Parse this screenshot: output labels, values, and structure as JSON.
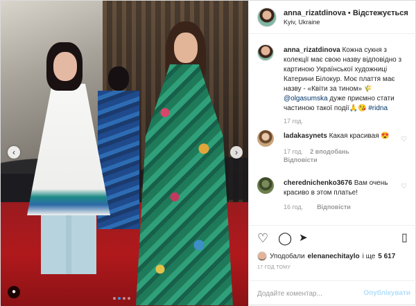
{
  "post": {
    "photo": {
      "dots_count": 4,
      "active_dot": 1
    }
  },
  "header": {
    "username": "anna_rizatdinova",
    "separator": "•",
    "follow_label": "Відстежується",
    "location": "Kyiv, Ukraine"
  },
  "caption": {
    "username": "anna_rizatdinova",
    "text_1": " Кожна сукня з колекції має свою назву відповідно з картиною Української художниці Катерини Білокур. Моє плаття має назву - «Квіти за тином» ",
    "emoji_1": "🌾",
    "mention": "@olgasumska",
    "text_2": " дуже приємно стати частиною такої події",
    "emoji_2": "🙏😘",
    "hashtag": "#ridna",
    "time": "17 год."
  },
  "comments": [
    {
      "username": "ladakasynets",
      "text": " Какая красивая 😍",
      "time": "17 год.",
      "likes": "2 вподобань",
      "reply": "Відповісти"
    },
    {
      "username": "cherednichenko3676",
      "text": " Вам очень красиво в этом платье!",
      "time": "16 год.",
      "reply": "Відповісти"
    }
  ],
  "likes": {
    "prefix": "Уподобали",
    "user": "elenanechitaylo",
    "connector": " і ще ",
    "count": "5 617"
  },
  "time_ago": "17 ГОД ТОМУ",
  "comment_box": {
    "placeholder": "Додайте коментар...",
    "publish_label": "Опублікувати"
  },
  "icons": {
    "prev": "chevron-left-icon",
    "next": "chevron-right-icon",
    "tag": "user-tag-icon",
    "like": "heart-icon",
    "comment": "comment-icon",
    "share": "share-icon",
    "save": "bookmark-icon"
  },
  "colors": {
    "link": "#003569",
    "accent": "#3897f0",
    "publish_disabled": "#b2dffc"
  }
}
